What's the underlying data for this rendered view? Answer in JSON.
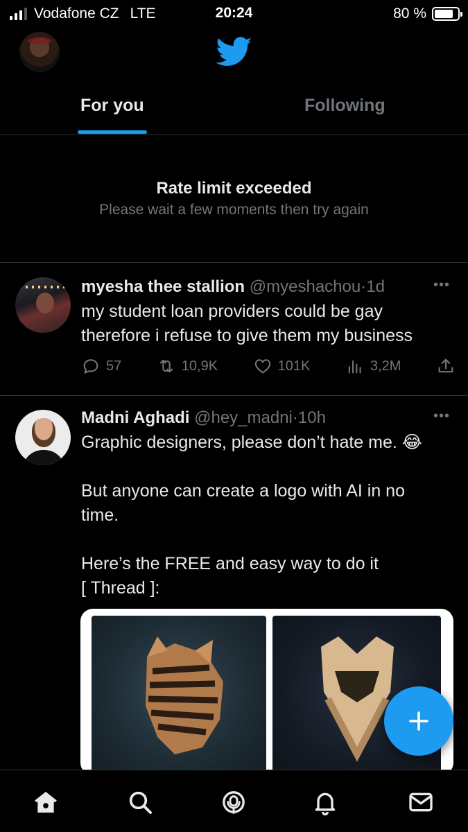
{
  "status_bar": {
    "carrier": "Vodafone CZ",
    "network": "LTE",
    "time": "20:24",
    "battery_percent_label": "80 %",
    "battery_level": 0.8,
    "signal_bars_active": 3,
    "signal_bars_total": 4
  },
  "header": {
    "logo": "bird-logo-icon",
    "avatar": "profile-avatar"
  },
  "tabs": [
    {
      "label": "For you",
      "active": true
    },
    {
      "label": "Following",
      "active": false
    }
  ],
  "notice": {
    "title": "Rate limit exceeded",
    "subtitle": "Please wait a few moments then try again"
  },
  "tweets": [
    {
      "name": "myesha thee stallion",
      "handle": "@myeshachou",
      "separator": "·",
      "time": "1d",
      "lines": [
        "my student loan providers could be gay",
        "therefore i refuse to give them my business"
      ],
      "replies": "57",
      "retweets": "10,9K",
      "likes": "101K",
      "views": "3,2M"
    },
    {
      "name": "Madni Aghadi",
      "handle": "@hey_madni",
      "separator": "·",
      "time": "10h",
      "lines": [
        "Graphic designers, please don’t hate me. 😂",
        "",
        "But anyone can create a logo with AI in no",
        "time.",
        "",
        "Here’s the FREE and easy way to do it",
        "[ Thread ]:"
      ]
    }
  ],
  "colors": {
    "accent": "#1d9bf0",
    "background": "#000000",
    "text": "#e7e9ea",
    "muted": "#71767b",
    "divider": "#2f3336"
  },
  "bottom_nav": [
    "home-icon",
    "search-icon",
    "spaces-icon",
    "notifications-icon",
    "messages-icon"
  ]
}
